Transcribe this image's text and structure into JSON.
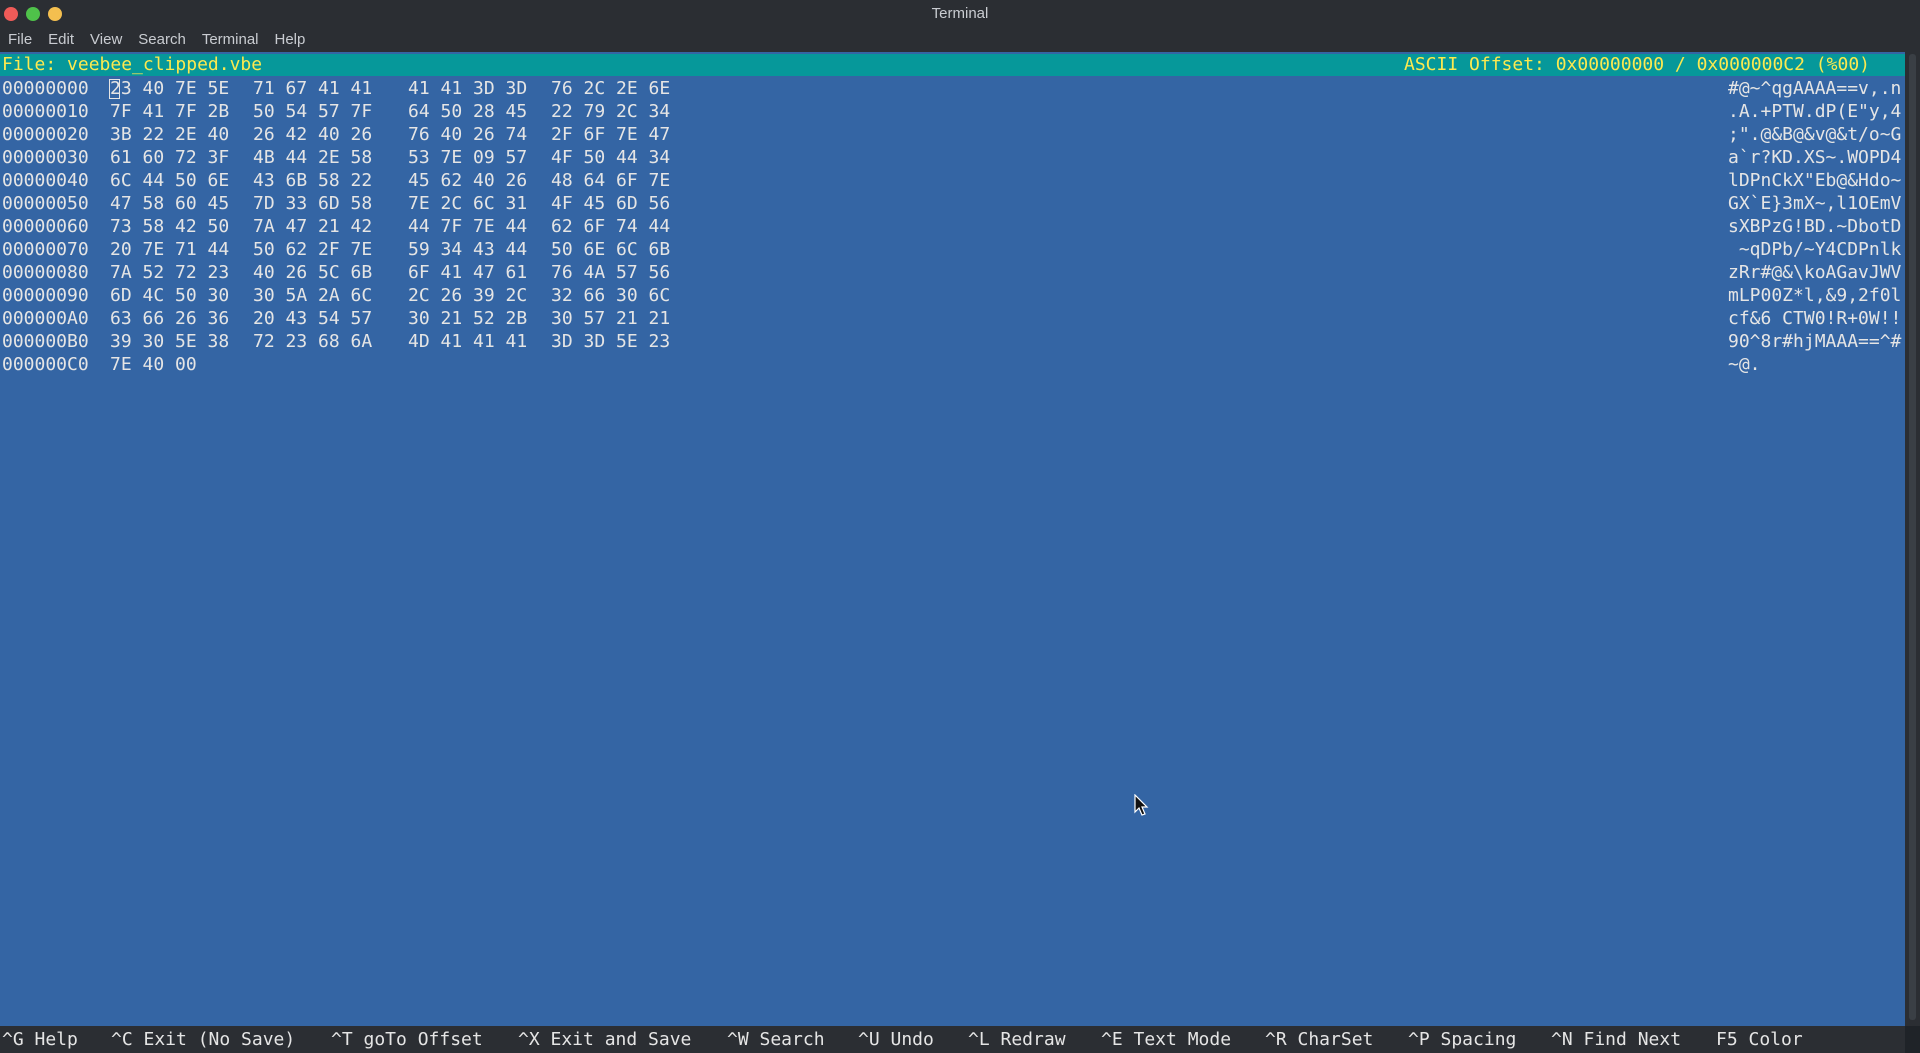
{
  "window": {
    "title": "Terminal"
  },
  "menu": [
    "File",
    "Edit",
    "View",
    "Search",
    "Terminal",
    "Help"
  ],
  "editor": {
    "file_label": "File: veebee_clipped.vbe",
    "offset_label": "ASCII Offset: 0x00000000 / 0x000000C2 (%00)"
  },
  "rows": [
    {
      "addr": "00000000",
      "g1": "23 40 7E 5E",
      "g2": "71 67 41 41",
      "g3": "41 41 3D 3D",
      "g4": "76 2C 2E 6E",
      "ascii": "#@~^qgAAAA==v,.n"
    },
    {
      "addr": "00000010",
      "g1": "7F 41 7F 2B",
      "g2": "50 54 57 7F",
      "g3": "64 50 28 45",
      "g4": "22 79 2C 34",
      "ascii": ".A.+PTW.dP(E\"y,4"
    },
    {
      "addr": "00000020",
      "g1": "3B 22 2E 40",
      "g2": "26 42 40 26",
      "g3": "76 40 26 74",
      "g4": "2F 6F 7E 47",
      "ascii": ";\".@&B@&v@&t/o~G"
    },
    {
      "addr": "00000030",
      "g1": "61 60 72 3F",
      "g2": "4B 44 2E 58",
      "g3": "53 7E 09 57",
      "g4": "4F 50 44 34",
      "ascii": "a`r?KD.XS~.WOPD4"
    },
    {
      "addr": "00000040",
      "g1": "6C 44 50 6E",
      "g2": "43 6B 58 22",
      "g3": "45 62 40 26",
      "g4": "48 64 6F 7E",
      "ascii": "lDPnCkX\"Eb@&Hdo~"
    },
    {
      "addr": "00000050",
      "g1": "47 58 60 45",
      "g2": "7D 33 6D 58",
      "g3": "7E 2C 6C 31",
      "g4": "4F 45 6D 56",
      "ascii": "GX`E}3mX~,l1OEmV"
    },
    {
      "addr": "00000060",
      "g1": "73 58 42 50",
      "g2": "7A 47 21 42",
      "g3": "44 7F 7E 44",
      "g4": "62 6F 74 44",
      "ascii": "sXBPzG!BD.~DbotD"
    },
    {
      "addr": "00000070",
      "g1": "20 7E 71 44",
      "g2": "50 62 2F 7E",
      "g3": "59 34 43 44",
      "g4": "50 6E 6C 6B",
      "ascii": " ~qDPb/~Y4CDPnlk"
    },
    {
      "addr": "00000080",
      "g1": "7A 52 72 23",
      "g2": "40 26 5C 6B",
      "g3": "6F 41 47 61",
      "g4": "76 4A 57 56",
      "ascii": "zRr#@&\\koAGavJWV"
    },
    {
      "addr": "00000090",
      "g1": "6D 4C 50 30",
      "g2": "30 5A 2A 6C",
      "g3": "2C 26 39 2C",
      "g4": "32 66 30 6C",
      "ascii": "mLP00Z*l,&9,2f0l"
    },
    {
      "addr": "000000A0",
      "g1": "63 66 26 36",
      "g2": "20 43 54 57",
      "g3": "30 21 52 2B",
      "g4": "30 57 21 21",
      "ascii": "cf&6 CTW0!R+0W!!"
    },
    {
      "addr": "000000B0",
      "g1": "39 30 5E 38",
      "g2": "72 23 68 6A",
      "g3": "4D 41 41 41",
      "g4": "3D 3D 5E 23",
      "ascii": "90^8r#hjMAAA==^#"
    },
    {
      "addr": "000000C0",
      "g1": "7E 40 00",
      "g2": "",
      "g3": "",
      "g4": "",
      "ascii": "~@."
    }
  ],
  "shortcuts": [
    {
      "label": "^G Help"
    },
    {
      "label": "^C Exit (No Save)"
    },
    {
      "label": "^T goTo Offset"
    },
    {
      "label": "^X Exit and Save"
    },
    {
      "label": "^W Search"
    },
    {
      "label": "^U Undo"
    },
    {
      "label": "^L Redraw"
    },
    {
      "label": "^E Text Mode"
    },
    {
      "label": "^R CharSet"
    },
    {
      "label": "^P Spacing"
    },
    {
      "label": "^N Find Next"
    },
    {
      "label": "F5 Color"
    }
  ],
  "colors": {
    "terminal_bg": "#3465a4",
    "status_bg": "#06989a",
    "status_fg": "#fce94f",
    "text": "#e5e5e5"
  }
}
